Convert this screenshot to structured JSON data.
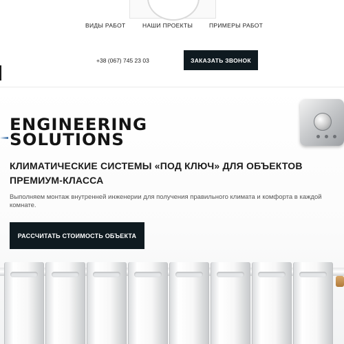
{
  "nav": {
    "items": [
      {
        "label": "ВИДЫ РАБОТ"
      },
      {
        "label": "НАШИ ПРОЕКТЫ"
      },
      {
        "label": "ПРИМЕРЫ РАБОТ"
      }
    ]
  },
  "contact": {
    "phone": "+38 (067) 745 23 03",
    "callback_label": "ЗАКАЗАТЬ ЗВОНОК"
  },
  "hero": {
    "brand_line1": "ENGINEERING",
    "brand_line2": "SOLUTIONS",
    "headline": "КЛИМАТИЧЕСКИЕ СИСТЕМЫ «ПОД КЛЮЧ» ДЛЯ ОБЪЕКТОВ ПРЕМИУМ-КЛАССА",
    "subtext": "Выполняем монтаж внутренней инженерии для получения правильного климата и комфорта в каждой комнате.",
    "cta_label": "РАССЧИТАТЬ СТОИМОСТЬ ОБЪЕКТА"
  },
  "colors": {
    "button_dark": "#0f1a20",
    "text_dark": "#1b1b1b",
    "text_muted": "#555555"
  },
  "icons": {
    "logo": "logo-emblem",
    "thermostat": "thermostat-image",
    "radiator": "radiator-image"
  }
}
